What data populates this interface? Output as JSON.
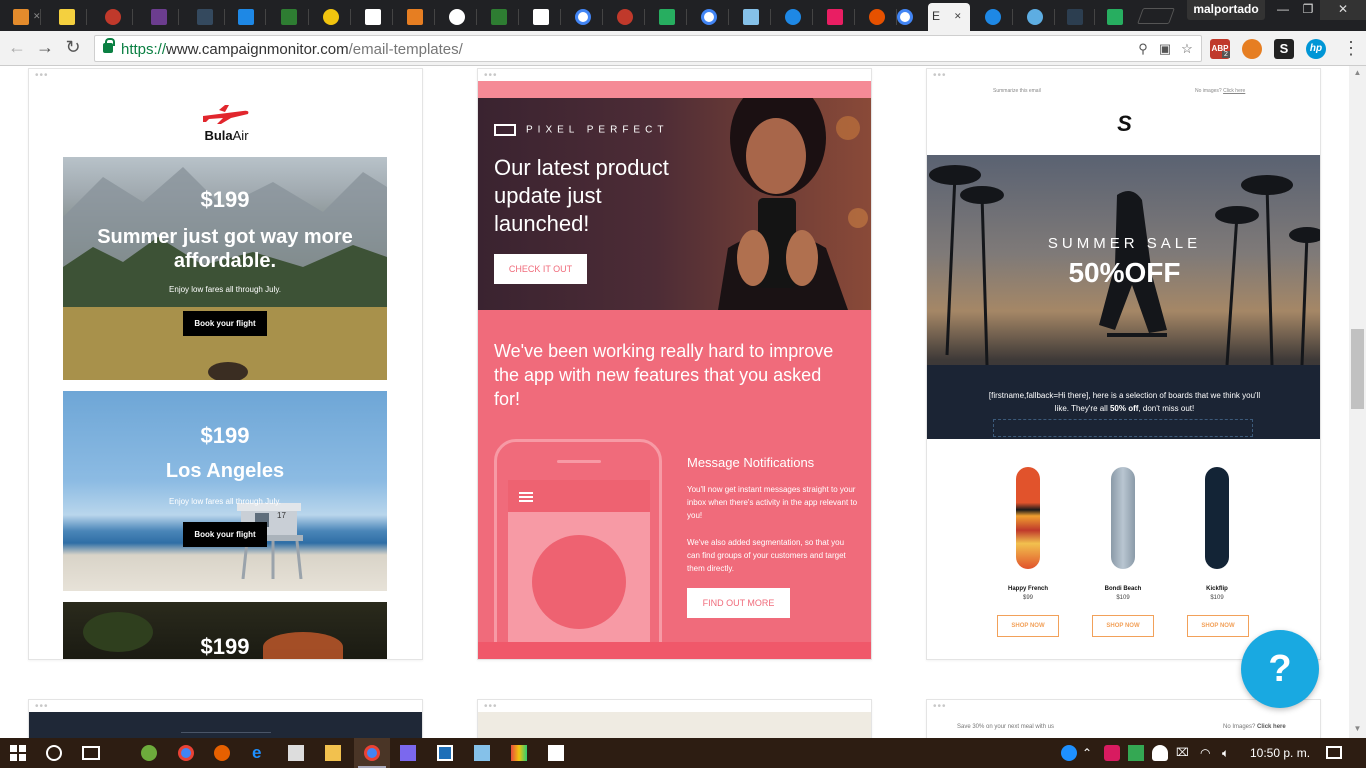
{
  "browser": {
    "active_tab_title": "E",
    "profile_name": "malportado",
    "url_scheme": "https://",
    "url_host": "www.campaignmonitor.com",
    "url_path": "/email-templates/",
    "extension_abp_label": "ABP",
    "extension_abp_badge": "2",
    "extension_s_label": "S",
    "extension_hp_label": "hp"
  },
  "templates": {
    "bula": {
      "brand_bold": "Bula",
      "brand_regular": "Air",
      "hero1_price": "$199",
      "hero1_title": "Summer just got way more affordable.",
      "hero1_sub": "Enjoy low fares all through July.",
      "hero1_button": "Book your flight",
      "hero2_price": "$199",
      "hero2_title": "Los Angeles",
      "hero2_sub": "Enjoy low fares all through July.",
      "hero2_button": "Book your flight",
      "tower_number": "17",
      "hero3_price": "$199"
    },
    "pixel": {
      "logo": "PIXEL PERFECT",
      "title": "Our latest product update just launched!",
      "cta": "CHECK IT OUT",
      "lead": "We've been working really hard to improve the app with new features that you asked for!",
      "feature_title": "Message Notifications",
      "feature_text_1": "You'll now get instant messages straight to your inbox when there's activity in the app relevant to you!",
      "feature_text_2": "We've also added segmentation, so that you can find groups of your customers and target them directly.",
      "cta2": "FIND OUT MORE"
    },
    "skate": {
      "summarize": "Summarize this email",
      "no_images": "No images?",
      "click_here": "Click here",
      "logo": "S",
      "sale": "SUMMER SALE",
      "off": "50%OFF",
      "msg_1": "[firstname,fallback=Hi there], here is a selection of boards that we think you'll like. They're all",
      "msg_bold": "50% off",
      "msg_2": ", don't miss out!",
      "boards": [
        {
          "name": "Happy French",
          "price": "$99",
          "button": "SHOP NOW"
        },
        {
          "name": "Bondi Beach",
          "price": "$109",
          "button": "SHOP NOW"
        },
        {
          "name": "Kickflip",
          "price": "$109",
          "button": "SHOP NOW"
        }
      ]
    },
    "bottom_right": {
      "left_text": "Save 30% on your next meal with us",
      "right_text": "No Images?",
      "right_link": "Click here"
    }
  },
  "help_button": "?",
  "taskbar": {
    "time": "10:50 p. m."
  },
  "colors": {
    "pixel_pink": "#f06b7b",
    "skate_orange": "#f2a15a",
    "help_blue": "#19a9e1",
    "secure_green": "#0b8043"
  }
}
